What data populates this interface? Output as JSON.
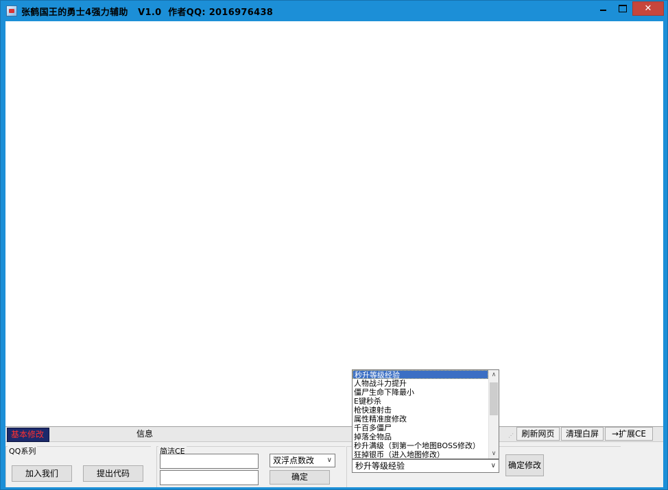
{
  "window": {
    "title": "张鹤国王的勇士4强力辅助   V1.0  作者QQ: 2016976438",
    "close_glyph": "✕"
  },
  "tabs": {
    "basic": "基本修改",
    "info": "信息"
  },
  "toolbar": {
    "refresh": "刷新网页",
    "clear": "清理白屏",
    "extend": "→扩展CE"
  },
  "qq_group": {
    "label": "QQ系列",
    "join": "加入我们",
    "submit": "提出代码"
  },
  "ce_group": {
    "label": "简洁CE",
    "input1_value": "",
    "input2_value": "",
    "type_selected": "双浮点数改",
    "confirm": "确定"
  },
  "mod_list": {
    "items": [
      "秒升等级经验",
      "人物战斗力提升",
      "僵尸生命下降最小",
      "E键秒杀",
      "枪快速射击",
      "属性精准度修改",
      "千百多僵尸",
      "掉落全物品",
      "秒升满级（到第一个地图BOSS修改）",
      "狂掉银币（进入地图修改）"
    ],
    "selected_index": 0,
    "combo_value": "秒升等级经验",
    "confirm_mod": "确定修改"
  }
}
